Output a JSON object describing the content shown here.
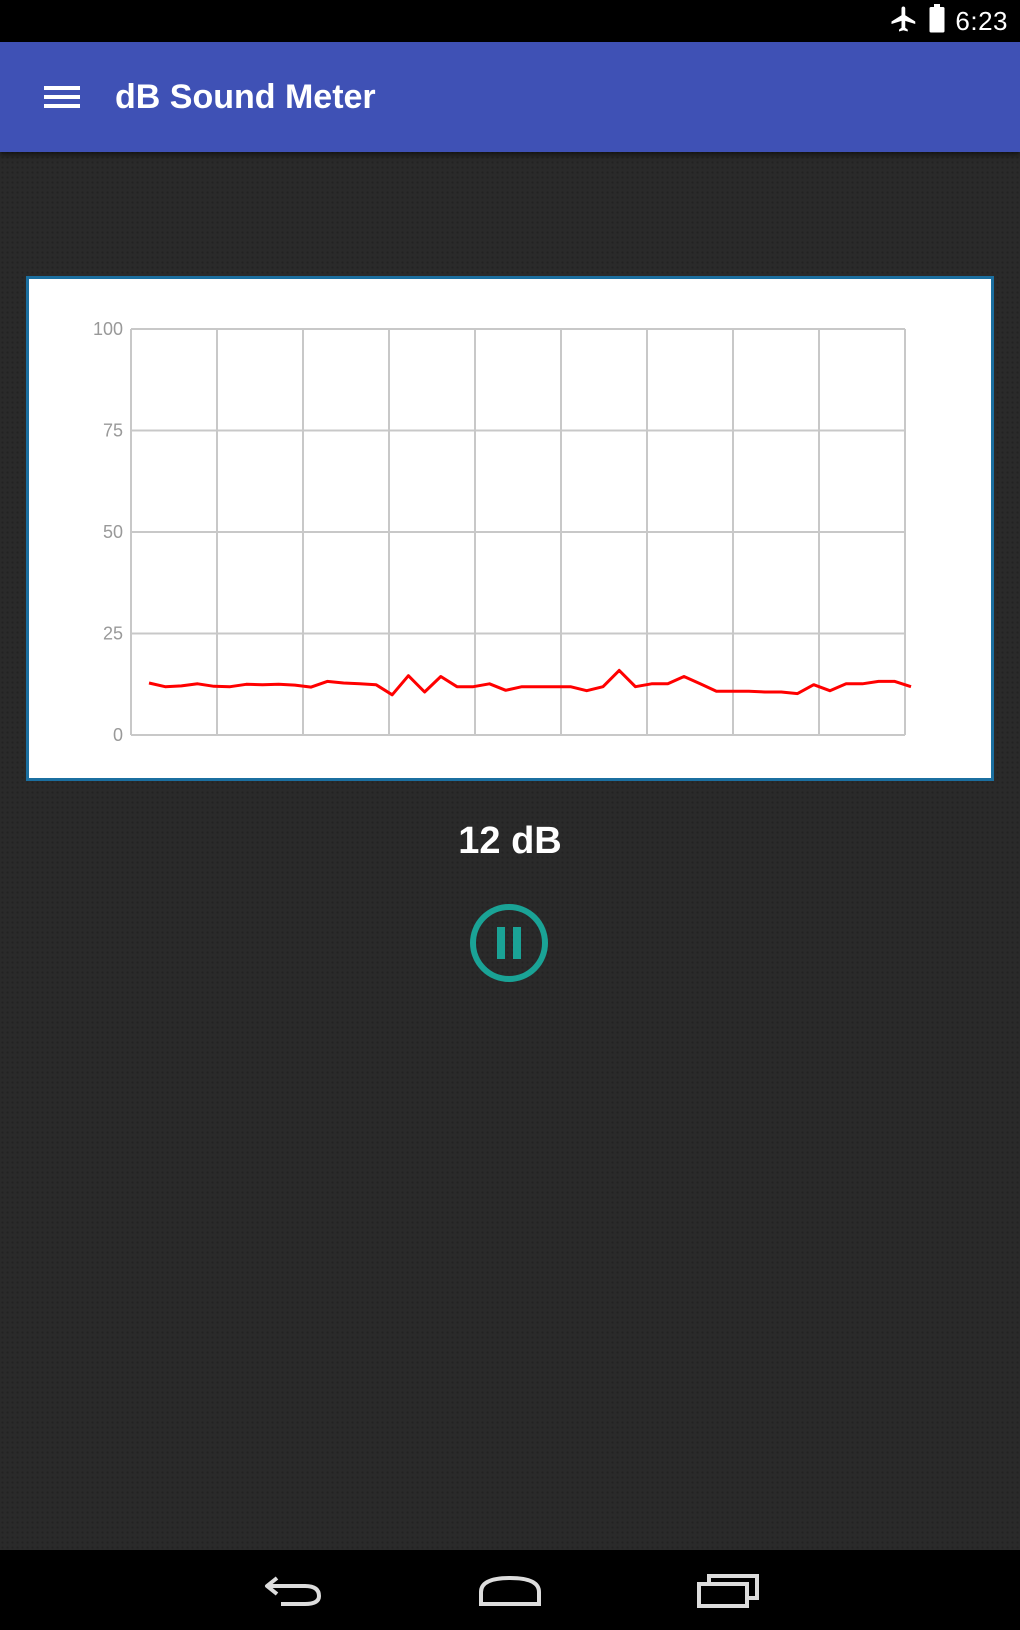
{
  "status_bar": {
    "time": "6:23",
    "icons": [
      "airplane-mode-icon",
      "battery-icon"
    ]
  },
  "app_bar": {
    "title": "dB Sound Meter",
    "menu_icon": "hamburger-menu-icon",
    "color": "#3f51b5"
  },
  "chart_data": {
    "type": "line",
    "title": "",
    "xlabel": "",
    "ylabel": "",
    "ylim": [
      0,
      100
    ],
    "yticks": [
      "0",
      "25",
      "50",
      "75",
      "100"
    ],
    "grid": true,
    "x_divisions": 9,
    "series": [
      {
        "color": "#ff0000",
        "values": [
          12.8,
          11.9,
          12.1,
          12.6,
          12.0,
          11.9,
          12.5,
          12.4,
          12.5,
          12.3,
          11.8,
          13.2,
          12.8,
          12.6,
          12.4,
          9.9,
          14.6,
          10.6,
          14.4,
          11.9,
          11.9,
          12.6,
          11.0,
          11.9,
          11.9,
          11.9,
          11.9,
          10.9,
          11.9,
          15.9,
          11.9,
          12.6,
          12.6,
          14.4,
          12.6,
          10.8,
          10.8,
          10.8,
          10.6,
          10.6,
          10.2,
          12.4,
          10.9,
          12.6,
          12.6,
          13.2,
          13.2,
          11.9
        ]
      }
    ]
  },
  "readout": {
    "value": "12 dB"
  },
  "controls": {
    "pause_icon": "pause-icon",
    "accent": "#1aa396"
  },
  "nav_bar": {
    "icons": [
      "back-icon",
      "home-icon",
      "recent-apps-icon"
    ]
  }
}
